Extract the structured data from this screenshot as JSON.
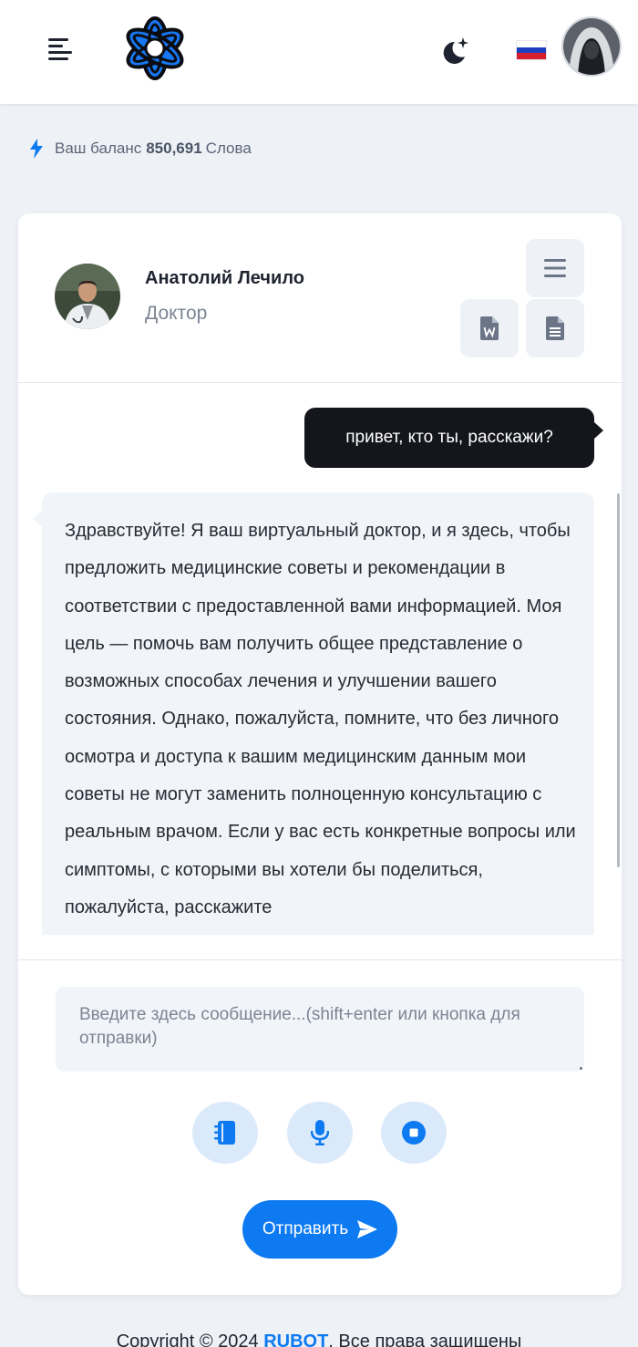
{
  "header": {
    "menu_icon": "hamburger-menu-icon",
    "logo_icon": "openai-style-knot-logo",
    "theme_icon": "moon-stars-icon",
    "language_flag": "russia-flag",
    "avatar_icon": "user-avatar-hooded-figure",
    "colors": {
      "accent": "#0d7af2",
      "logo": "#1877f2"
    }
  },
  "balance": {
    "icon": "lightning-icon",
    "label": "Ваш баланс",
    "amount": "850,691",
    "unit": "Слова"
  },
  "bot": {
    "name": "Анатолий Лечило",
    "role": "Доктор",
    "avatar_icon": "doctor-avatar",
    "actions": {
      "menu_icon": "list-menu-icon",
      "word_icon": "word-document-icon",
      "text_icon": "text-document-icon"
    }
  },
  "messages": [
    {
      "from": "user",
      "text": "привет, кто ты, расскажи?"
    },
    {
      "from": "bot",
      "text": "Здравствуйте! Я ваш виртуальный доктор, и я здесь, чтобы предложить медицинские советы и рекомендации в соответствии с предоставленной вами информацией. Моя цель — помочь вам получить общее представление о возможных способах лечения и улучшении вашего состояния. Однако, пожалуйста, помните, что без личного осмотра и доступа к вашим медицинским данным мои советы не могут заменить полноценную консультацию с реальным врачом. Если у вас есть конкретные вопросы или симптомы, с которыми вы хотели бы поделиться, пожалуйста, расскажите"
    }
  ],
  "composer": {
    "placeholder": "Введите здесь сообщение...(shift+enter или кнопка для отправки)",
    "value": "",
    "buttons": {
      "prompts_icon": "notebook-icon",
      "mic_icon": "microphone-icon",
      "stop_icon": "stop-icon"
    },
    "send_label": "Отправить",
    "send_icon": "paper-plane-icon"
  },
  "footer": {
    "prefix": "Copyright © 2024",
    "brand": "RUBOT",
    "suffix": "Все права защищены"
  }
}
